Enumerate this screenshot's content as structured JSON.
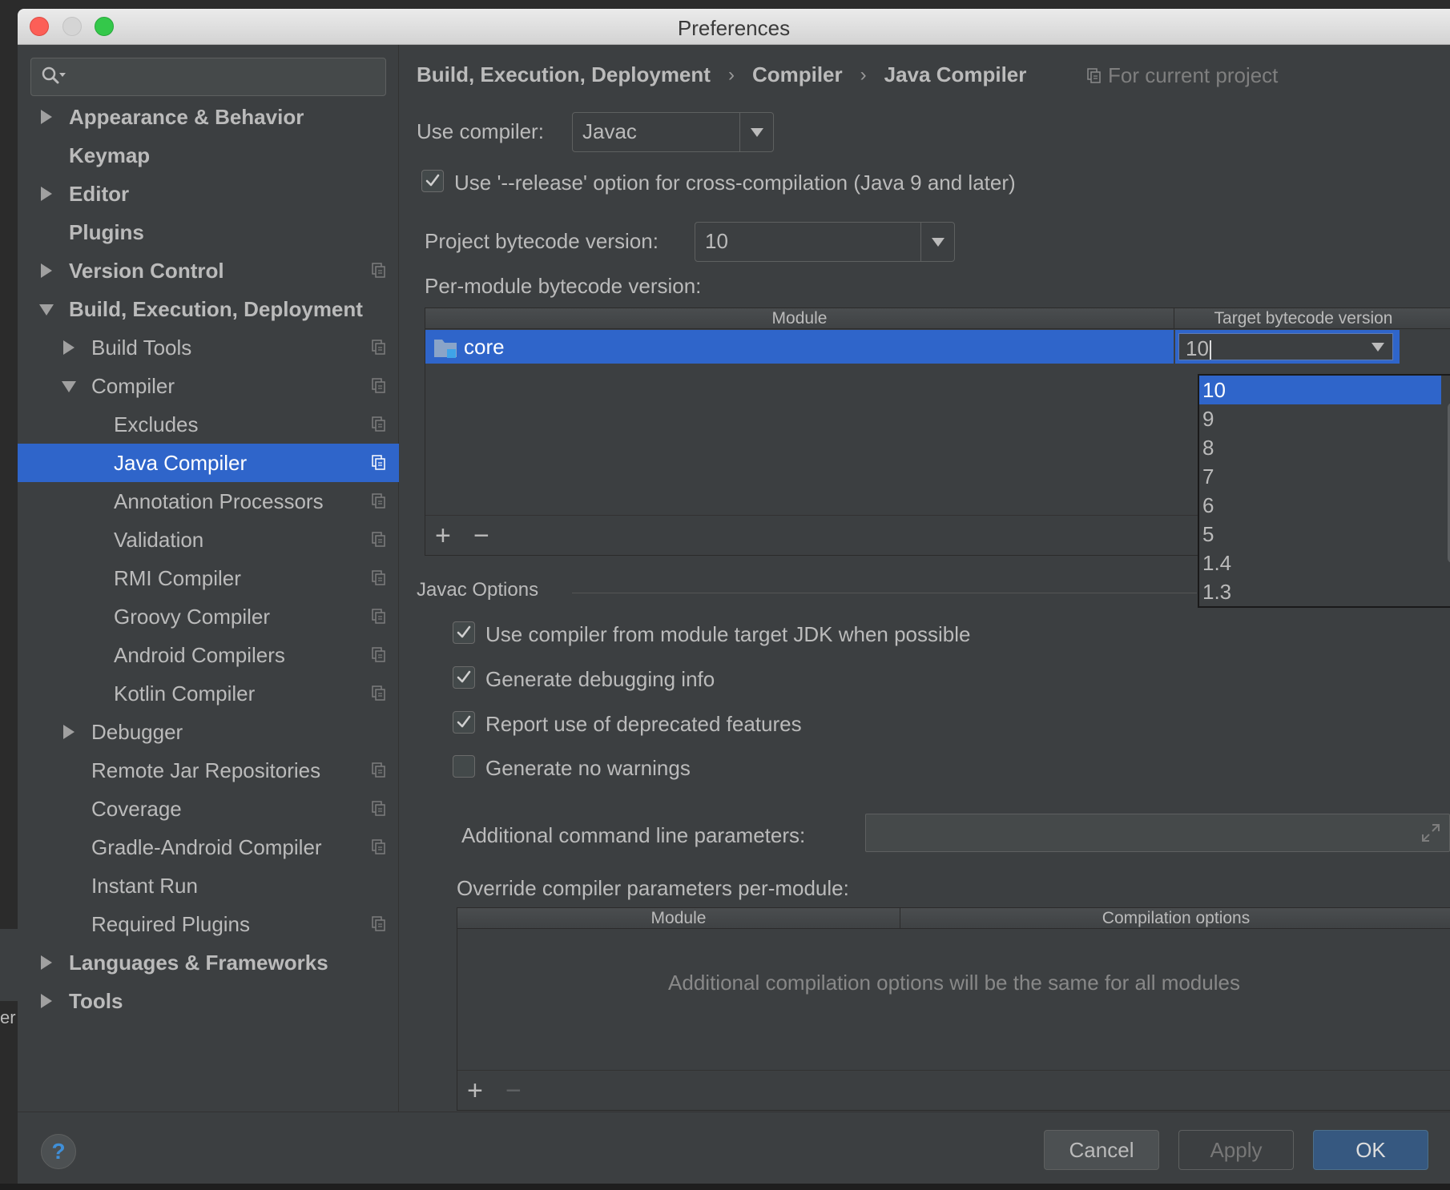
{
  "window": {
    "title": "Preferences"
  },
  "search": {
    "placeholder": ""
  },
  "sidebar": {
    "items": [
      {
        "label": "Appearance & Behavior",
        "expander": "collapsed",
        "bold": true,
        "project_icon": false
      },
      {
        "label": "Keymap",
        "expander": "none",
        "bold": true,
        "project_icon": false
      },
      {
        "label": "Editor",
        "expander": "collapsed",
        "bold": true,
        "project_icon": false
      },
      {
        "label": "Plugins",
        "expander": "none",
        "bold": true,
        "project_icon": false
      },
      {
        "label": "Version Control",
        "expander": "collapsed",
        "bold": true,
        "project_icon": true
      },
      {
        "label": "Build, Execution, Deployment",
        "expander": "expanded",
        "bold": true,
        "project_icon": false
      },
      {
        "label": "Build Tools",
        "expander": "collapsed",
        "bold": false,
        "project_icon": true
      },
      {
        "label": "Compiler",
        "expander": "expanded",
        "bold": false,
        "project_icon": true
      },
      {
        "label": "Excludes",
        "expander": "none",
        "bold": false,
        "project_icon": true
      },
      {
        "label": "Java Compiler",
        "expander": "none",
        "bold": false,
        "project_icon": true,
        "selected": true
      },
      {
        "label": "Annotation Processors",
        "expander": "none",
        "bold": false,
        "project_icon": true
      },
      {
        "label": "Validation",
        "expander": "none",
        "bold": false,
        "project_icon": true
      },
      {
        "label": "RMI Compiler",
        "expander": "none",
        "bold": false,
        "project_icon": true
      },
      {
        "label": "Groovy Compiler",
        "expander": "none",
        "bold": false,
        "project_icon": true
      },
      {
        "label": "Android Compilers",
        "expander": "none",
        "bold": false,
        "project_icon": true
      },
      {
        "label": "Kotlin Compiler",
        "expander": "none",
        "bold": false,
        "project_icon": true
      },
      {
        "label": "Debugger",
        "expander": "collapsed",
        "bold": false,
        "project_icon": false
      },
      {
        "label": "Remote Jar Repositories",
        "expander": "none",
        "bold": false,
        "project_icon": true
      },
      {
        "label": "Coverage",
        "expander": "none",
        "bold": false,
        "project_icon": true
      },
      {
        "label": "Gradle-Android Compiler",
        "expander": "none",
        "bold": false,
        "project_icon": true
      },
      {
        "label": "Instant Run",
        "expander": "none",
        "bold": false,
        "project_icon": false
      },
      {
        "label": "Required Plugins",
        "expander": "none",
        "bold": false,
        "project_icon": true
      },
      {
        "label": "Languages & Frameworks",
        "expander": "collapsed",
        "bold": true,
        "project_icon": false
      },
      {
        "label": "Tools",
        "expander": "collapsed",
        "bold": true,
        "project_icon": false
      }
    ]
  },
  "breadcrumb": {
    "items": [
      "Build, Execution, Deployment",
      "Compiler",
      "Java Compiler"
    ],
    "separator": "›",
    "scope": "For current project"
  },
  "compiler": {
    "use_compiler_label": "Use compiler:",
    "use_compiler_value": "Javac",
    "release_option_label": "Use '--release' option for cross-compilation (Java 9 and later)",
    "release_option_checked": true,
    "project_bytecode_label": "Project bytecode version:",
    "project_bytecode_value": "10",
    "per_module_label": "Per-module bytecode version:",
    "module_table": {
      "columns": [
        "Module",
        "Target bytecode version"
      ],
      "rows": [
        {
          "module": "core",
          "target": "10"
        }
      ],
      "add_label": "+",
      "remove_label": "−"
    },
    "version_popup": {
      "options": [
        "10",
        "9",
        "8",
        "7",
        "6",
        "5",
        "1.4",
        "1.3"
      ],
      "selected": "10"
    }
  },
  "javac": {
    "section_title": "Javac Options",
    "options": [
      {
        "label": "Use compiler from module target JDK when possible",
        "checked": true
      },
      {
        "label": "Generate debugging info",
        "checked": true
      },
      {
        "label": "Report use of deprecated features",
        "checked": true
      },
      {
        "label": "Generate no warnings",
        "checked": false
      }
    ],
    "additional_params_label": "Additional command line parameters:",
    "additional_params_value": "",
    "override_label": "Override compiler parameters per-module:",
    "override_table": {
      "columns": [
        "Module",
        "Compilation options"
      ],
      "empty_text": "Additional compilation options will be the same for all modules",
      "add_label": "+",
      "remove_label": "−"
    }
  },
  "footer": {
    "help_label": "?",
    "cancel_label": "Cancel",
    "apply_label": "Apply",
    "ok_label": "OK"
  },
  "background_fragment": "er",
  "colors": {
    "selection": "#2f65ca",
    "panel": "#3c3f41",
    "text": "#bbbbbb",
    "ok_button": "#365880",
    "help_icon": "#3f8fd8"
  }
}
